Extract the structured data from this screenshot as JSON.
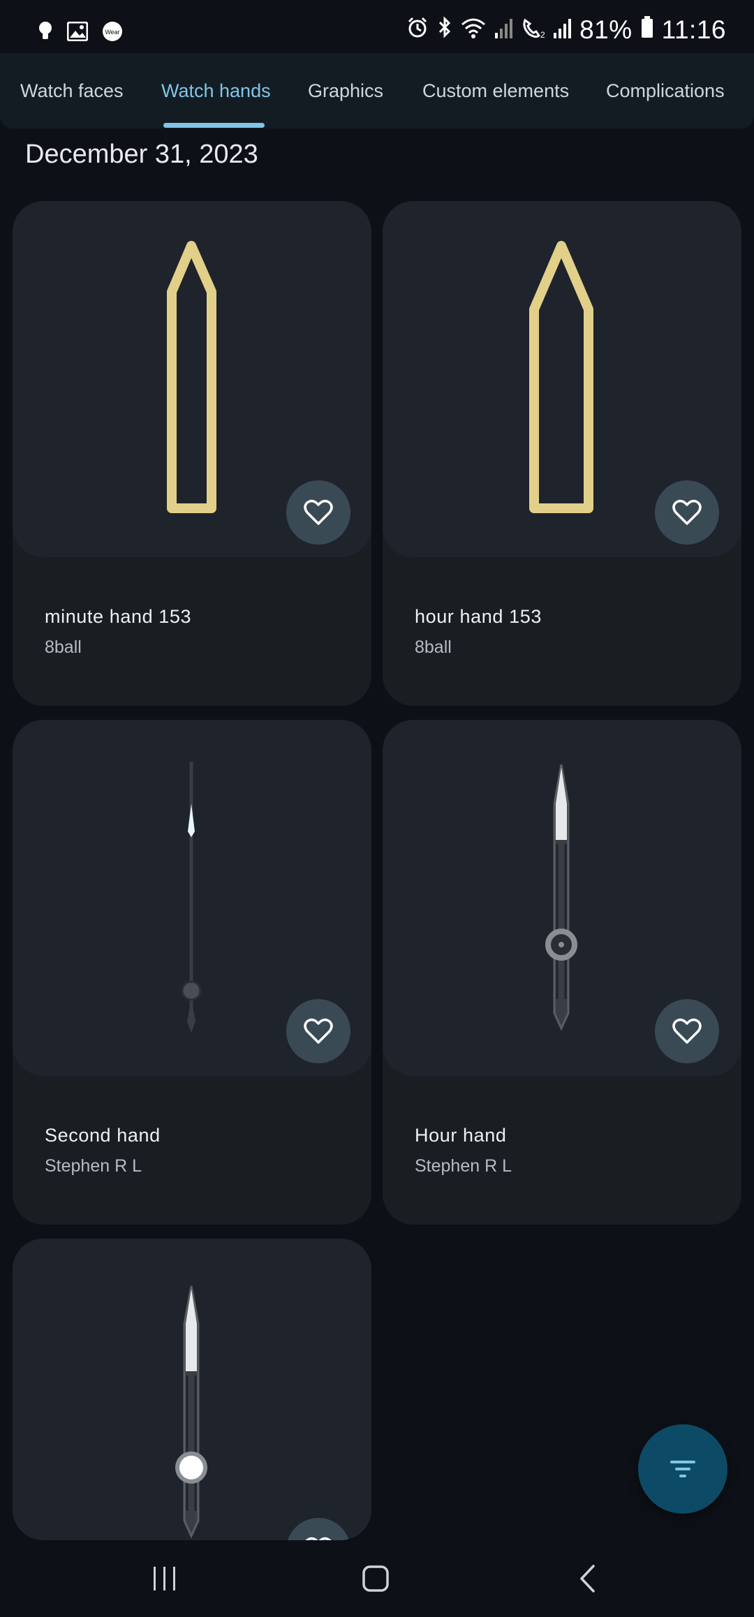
{
  "status_bar": {
    "battery": "81%",
    "time": "11:16"
  },
  "tabs": [
    {
      "label": "Watch faces"
    },
    {
      "label": "Watch hands",
      "active": true
    },
    {
      "label": "Graphics"
    },
    {
      "label": "Custom elements"
    },
    {
      "label": "Complications"
    }
  ],
  "date_header": "December 31, 2023",
  "cards": [
    {
      "title": "minute hand 153",
      "author": "8ball",
      "hand_color": "#e2cf8a"
    },
    {
      "title": "hour hand 153",
      "author": "8ball",
      "hand_color": "#e2cf8a"
    },
    {
      "title": "Second hand",
      "author": "Stephen R L"
    },
    {
      "title": "Hour hand",
      "author": "Stephen R L"
    },
    {
      "title": "",
      "author": ""
    }
  ],
  "icons": {
    "favorite": "heart-outline-icon",
    "filter": "filter-list-icon"
  },
  "colors": {
    "accent": "#7fc6e8",
    "fab": "#0d4a66",
    "background": "#0d1117"
  }
}
